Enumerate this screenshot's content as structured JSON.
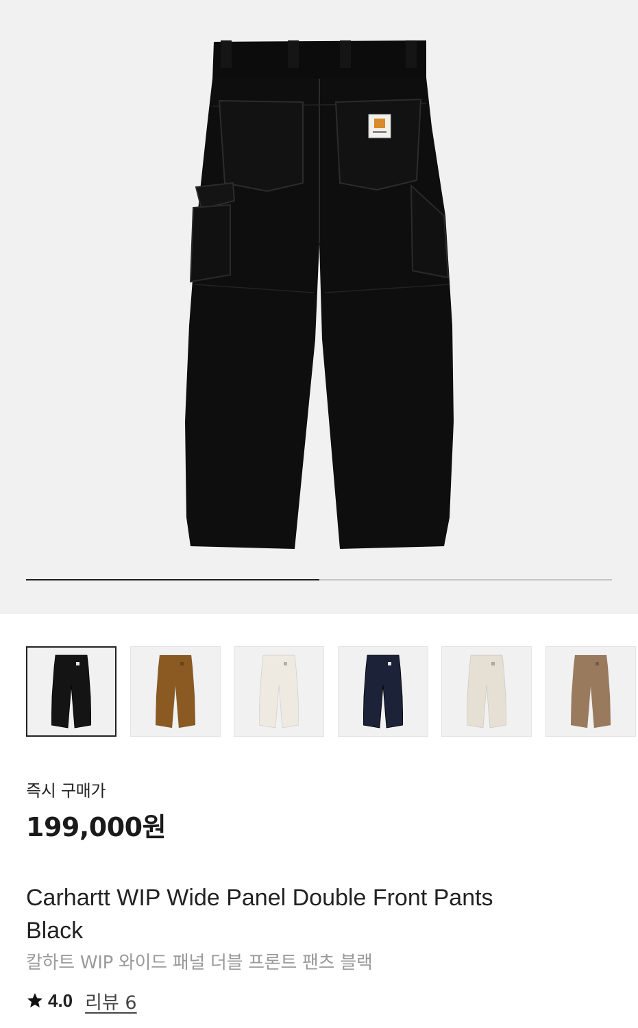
{
  "gallery": {
    "progress_fraction": 0.5
  },
  "thumbnails": [
    {
      "color_name": "black",
      "color": "#141414",
      "selected": true
    },
    {
      "color_name": "hamilton-brown",
      "color": "#8a5a22",
      "selected": false
    },
    {
      "color_name": "wax",
      "color": "#eeeae2",
      "selected": false
    },
    {
      "color_name": "navy",
      "color": "#1c2238",
      "selected": false
    },
    {
      "color_name": "natural",
      "color": "#e6dfd3",
      "selected": false
    },
    {
      "color_name": "tan",
      "color": "#9a7a5c",
      "selected": false
    }
  ],
  "pricing": {
    "label": "즉시 구매가",
    "price": "199,000원"
  },
  "product": {
    "name": "Carhartt WIP Wide Panel Double Front Pants Black",
    "name_ko": "칼하트 WIP 와이드 패널 더블 프론트 팬츠 블랙"
  },
  "rating": {
    "value": "4.0",
    "reviews_label": "리뷰 6"
  },
  "icons": {
    "rating": "star-icon"
  }
}
